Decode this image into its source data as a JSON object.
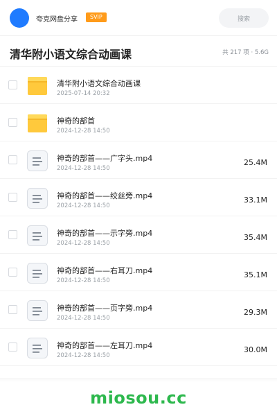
{
  "header": {
    "user_name": "夸克网盘分享",
    "badge": "SVIP",
    "search_placeholder": "搜索"
  },
  "title_bar": {
    "title": "清华附小语文综合动画课",
    "summary": "共 217 项 · 5.6G"
  },
  "files": [
    {
      "type": "folder",
      "name": "清华附小语文综合动画课",
      "date": "2025-07-14 20:32",
      "size": ""
    },
    {
      "type": "folder",
      "name": "神奇的部首",
      "date": "2024-12-28 14:50",
      "size": ""
    },
    {
      "type": "file",
      "name": "神奇的部首——广字头.mp4",
      "date": "2024-12-28 14:50",
      "size": "25.4M"
    },
    {
      "type": "file",
      "name": "神奇的部首——绞丝旁.mp4",
      "date": "2024-12-28 14:50",
      "size": "33.1M"
    },
    {
      "type": "file",
      "name": "神奇的部首——示字旁.mp4",
      "date": "2024-12-28 14:50",
      "size": "35.4M"
    },
    {
      "type": "file",
      "name": "神奇的部首——右耳刀.mp4",
      "date": "2024-12-28 14:50",
      "size": "35.1M"
    },
    {
      "type": "file",
      "name": "神奇的部首——页字旁.mp4",
      "date": "2024-12-28 14:50",
      "size": "29.3M"
    },
    {
      "type": "file",
      "name": "神奇的部首——左耳刀.mp4",
      "date": "2024-12-28 14:50",
      "size": "30.0M"
    }
  ],
  "watermark": "miosou.cc",
  "colors": {
    "avatar": "#1f7bff",
    "badge": "#ff9b1a",
    "folder": "#ffc93c",
    "watermark": "#2db84d"
  },
  "icons": {
    "folder": "folder-icon",
    "file": "document-icon"
  }
}
